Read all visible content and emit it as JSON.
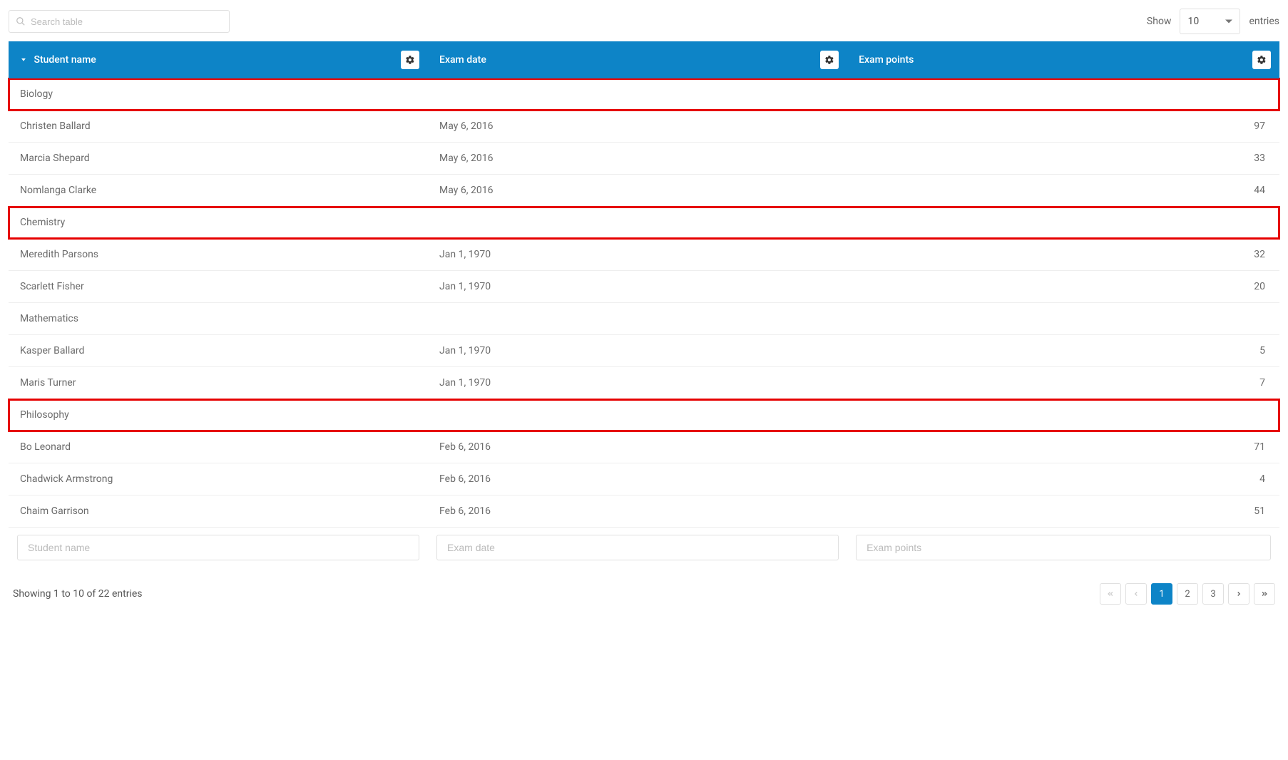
{
  "topbar": {
    "search_placeholder": "Search table",
    "show_label": "Show",
    "entries_label": "entries",
    "page_size": "10"
  },
  "columns": {
    "name": {
      "label": "Student name"
    },
    "date": {
      "label": "Exam date"
    },
    "points": {
      "label": "Exam points"
    }
  },
  "filters": {
    "name_placeholder": "Student name",
    "date_placeholder": "Exam date",
    "points_placeholder": "Exam points"
  },
  "rows": [
    {
      "type": "group",
      "highlighted": true,
      "label": "Biology"
    },
    {
      "type": "data",
      "name": "Christen Ballard",
      "date": "May 6, 2016",
      "points": "97"
    },
    {
      "type": "data",
      "name": "Marcia Shepard",
      "date": "May 6, 2016",
      "points": "33"
    },
    {
      "type": "data",
      "name": "Nomlanga Clarke",
      "date": "May 6, 2016",
      "points": "44"
    },
    {
      "type": "group",
      "highlighted": true,
      "label": "Chemistry"
    },
    {
      "type": "data",
      "name": "Meredith Parsons",
      "date": "Jan 1, 1970",
      "points": "32"
    },
    {
      "type": "data",
      "name": "Scarlett Fisher",
      "date": "Jan 1, 1970",
      "points": "20"
    },
    {
      "type": "group",
      "highlighted": false,
      "label": "Mathematics"
    },
    {
      "type": "data",
      "name": "Kasper Ballard",
      "date": "Jan 1, 1970",
      "points": "5"
    },
    {
      "type": "data",
      "name": "Maris Turner",
      "date": "Jan 1, 1970",
      "points": "7"
    },
    {
      "type": "group",
      "highlighted": true,
      "label": "Philosophy"
    },
    {
      "type": "data",
      "name": "Bo Leonard",
      "date": "Feb 6, 2016",
      "points": "71"
    },
    {
      "type": "data",
      "name": "Chadwick Armstrong",
      "date": "Feb 6, 2016",
      "points": "4"
    },
    {
      "type": "data",
      "name": "Chaim Garrison",
      "date": "Feb 6, 2016",
      "points": "51"
    }
  ],
  "footer": {
    "showing_text": "Showing 1 to 10 of 22 entries"
  },
  "pagination": {
    "pages": [
      "1",
      "2",
      "3"
    ],
    "active": "1"
  }
}
